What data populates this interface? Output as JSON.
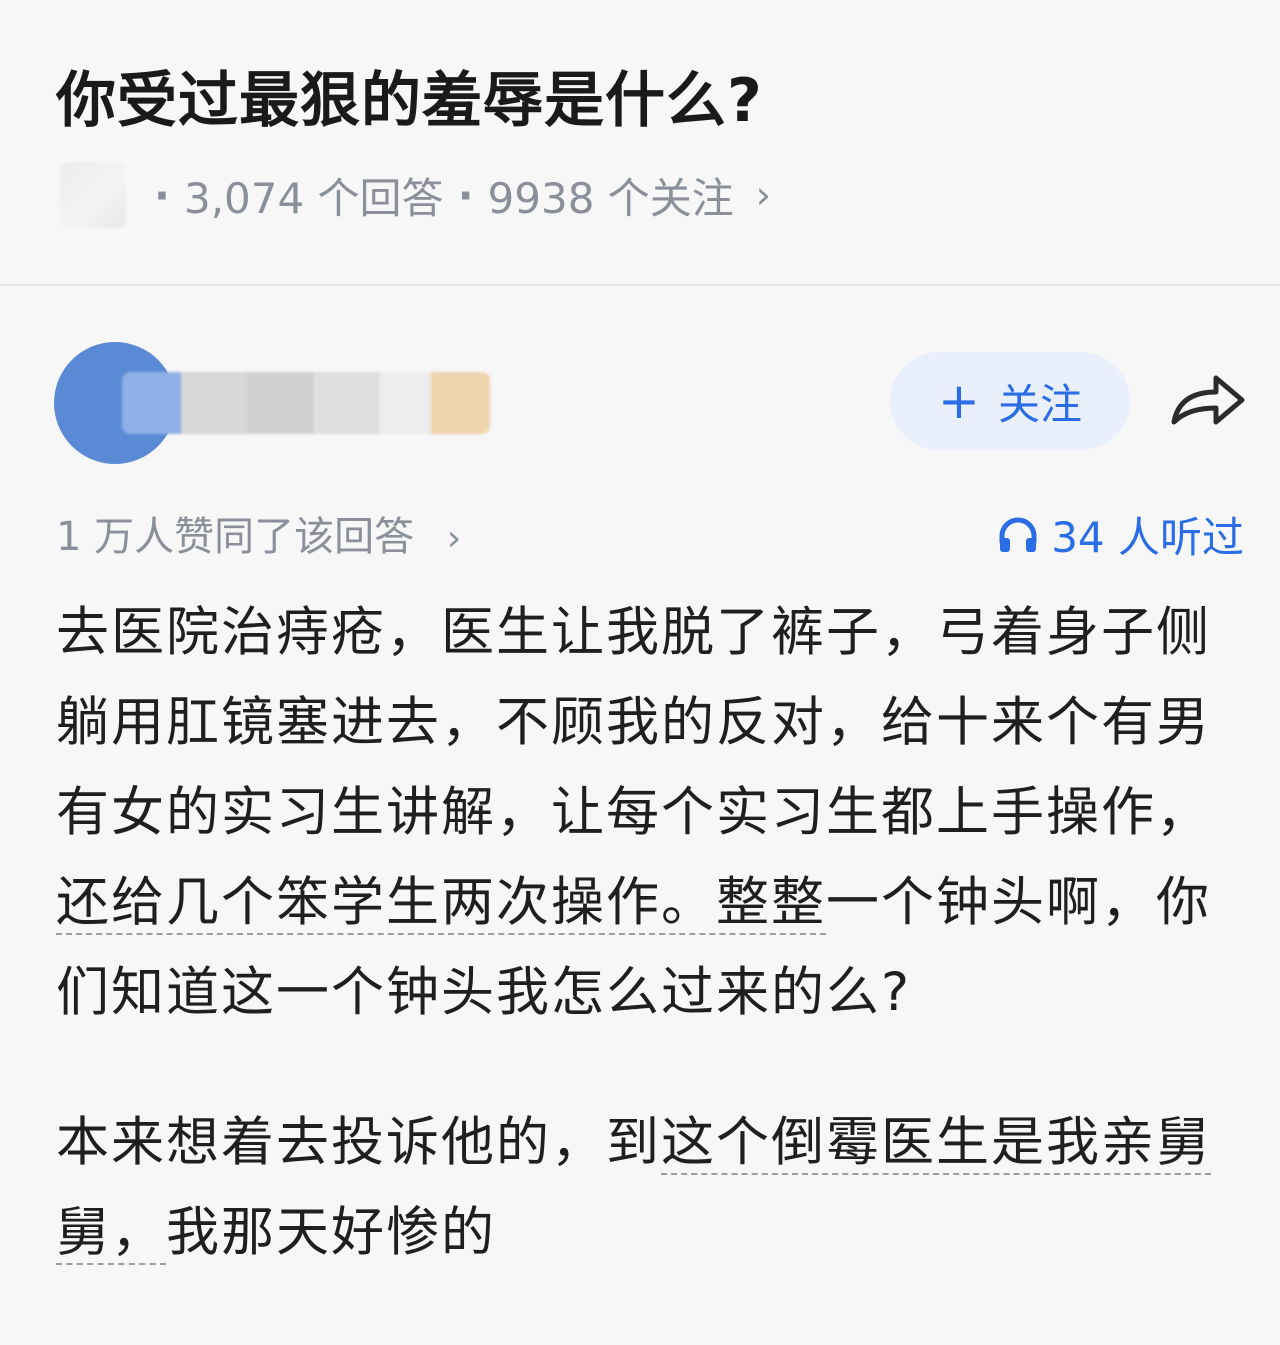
{
  "question": {
    "title": "你受过最狠的羞辱是什么?",
    "answers_count": "3,074 个回答",
    "followers_count": "9938 个关注",
    "separator": "·",
    "chevron": "›"
  },
  "answer": {
    "follow_label": "关注",
    "follow_plus": "+",
    "votes_text": "1 万人赞同了该回答",
    "votes_chevron": "›",
    "listened_text": "34 人听过",
    "paragraph1": {
      "part1": "去医院治痔疮，医生让我脱了裤子，弓着身子侧躺用肛镜塞进去，不顾我的反对，给十来个有男有女的实习生讲解，让每个实习生都上手操作，",
      "link1": "还给几个笨学生两次操作。整整",
      "part2": "一个钟头啊，你们知道这一个钟头我怎么过来的么?"
    },
    "paragraph2": {
      "part1": "本来想着去投诉他的，到",
      "link1": "这个倒霉医生是我亲舅舅，",
      "part2": "我那天好惨的"
    }
  },
  "colors": {
    "accent": "#2a6de6",
    "muted": "#8a8f99",
    "background": "#f7f7f7"
  }
}
